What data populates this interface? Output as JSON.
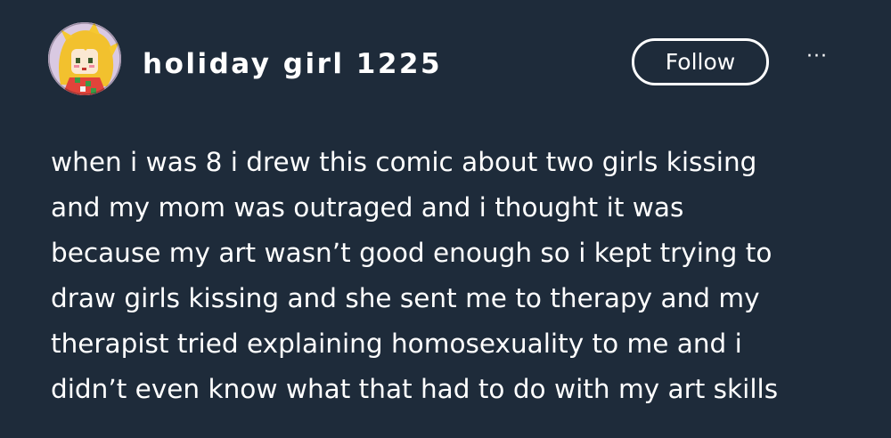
{
  "post": {
    "author": {
      "name": "holiday girl 1225",
      "avatar_icon": "pixel-art-girl-avatar"
    },
    "follow_label": "Follow",
    "more_icon": "ellipsis-icon",
    "more_label": "···",
    "body_lines": [
      "when i was 8 i drew this comic about two girls kissing",
      "and my mom was outraged and i thought it was",
      "because my art wasn’t good enough so i kept trying to",
      "draw girls kissing and she sent me to therapy and my",
      "therapist tried explaining homosexuality to me and i",
      "didn’t even know what that had to do with my art skills"
    ]
  },
  "colors": {
    "background": "#1e2b3a",
    "text": "#ffffff"
  }
}
